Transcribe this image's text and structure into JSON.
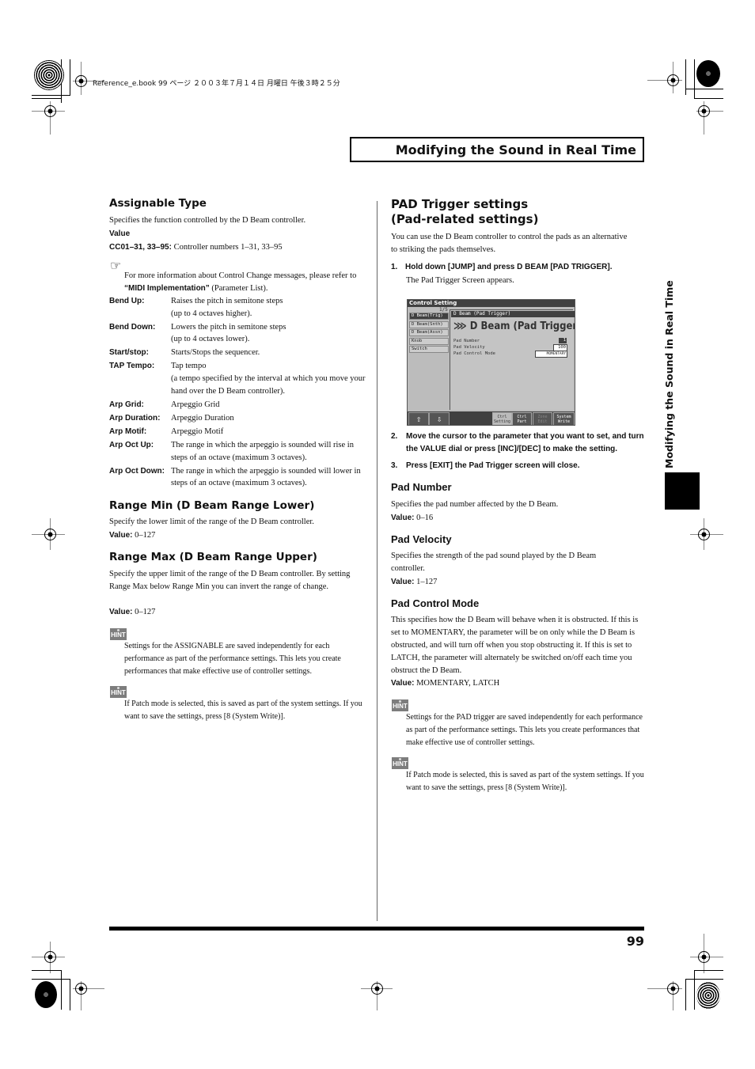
{
  "print_meta": {
    "file_info": "Reference_e.book  99 ページ  ２００３年７月１４日  月曜日  午後３時２５分"
  },
  "header": {
    "section_title": "Modifying the Sound in Real Time"
  },
  "side_tab": {
    "label": "Modifying the Sound in Real Time"
  },
  "left_column": {
    "assignable_type": {
      "heading": "Assignable Type",
      "description": "Specifies the function controlled by the D Beam controller.",
      "value_label": "Value",
      "cc_term": "CC01–31, 33–95:",
      "cc_desc": "Controller numbers 1–31, 33–95",
      "reference_icon": "pointing-hand-icon",
      "reference_text_1": "For more information about Control Change messages, please refer to ",
      "reference_link": "“MIDI Implementation”",
      "reference_text_2": " (Parameter List).",
      "definitions": [
        {
          "term": "Bend Up:",
          "desc": "Raises the pitch in semitone steps",
          "desc2": "(up to 4 octaves higher)."
        },
        {
          "term": "Bend Down:",
          "desc": "Lowers the pitch in semitone steps",
          "desc2": "(up to 4 octaves lower)."
        },
        {
          "term": "Start/stop:",
          "desc": "Starts/Stops the sequencer.",
          "desc2": ""
        },
        {
          "term": "TAP Tempo:",
          "desc": "Tap tempo",
          "desc2": "(a tempo specified by the interval at which you move your hand over the D Beam controller)."
        },
        {
          "term": "Arp Grid:",
          "desc": "Arpeggio Grid",
          "desc2": ""
        },
        {
          "term": "Arp Duration:",
          "desc": "Arpeggio Duration",
          "desc2": ""
        },
        {
          "term": "Arp Motif:",
          "desc": "Arpeggio Motif",
          "desc2": ""
        },
        {
          "term": "Arp Oct Up:",
          "desc": "The range in which the arpeggio is sounded will rise in steps of an octave (maximum 3 octaves).",
          "desc2": ""
        },
        {
          "term": "Arp Oct Down:",
          "desc": "The range in which the arpeggio is sounded will lower in steps of an octave (maximum 3 octaves).",
          "desc2": ""
        }
      ]
    },
    "range_min": {
      "heading": "Range Min (D Beam Range Lower)",
      "description": "Specify the lower limit of the range of the D Beam controller.",
      "value_label": "Value:",
      "value": "0–127"
    },
    "range_max": {
      "heading": "Range Max (D Beam Range Upper)",
      "description": "Specify the upper limit of the range of the D Beam controller. By setting Range Max below Range Min you can invert the range of change.",
      "value_label": "Value:",
      "value": "0–127"
    },
    "hints": [
      {
        "icon_label": "HINT",
        "text": "Settings for the ASSIGNABLE are saved independently for each performance as part of the performance settings. This lets you create performances that make effective use of controller settings."
      },
      {
        "icon_label": "HINT",
        "text": "If Patch mode is selected, this is saved as part of the system settings. If you want to save the settings, press [8 (System Write)]."
      }
    ]
  },
  "right_column": {
    "heading_line1": "PAD Trigger settings",
    "heading_line2": "(Pad-related settings)",
    "intro": "You can use the D Beam controller to control the pads as an alternative to striking the pads themselves.",
    "steps": [
      {
        "num": "1.",
        "text": "Hold down [JUMP] and press D BEAM [PAD TRIGGER].",
        "sub": "The Pad Trigger Screen appears."
      },
      {
        "num": "2.",
        "text": "Move the cursor to the parameter that you want to set, and turn the VALUE dial or press [INC]/[DEC] to make the setting.",
        "sub": ""
      },
      {
        "num": "3.",
        "text": "Press [EXIT] the Pad Trigger screen will close.",
        "sub": ""
      }
    ],
    "screen": {
      "title": "Control Setting",
      "page": "1/5",
      "menu": [
        {
          "label": "D Beam(Trig)",
          "active": true
        },
        {
          "label": "D Beam(Snth)",
          "active": false
        },
        {
          "label": "D Beam(Assn)",
          "active": false
        },
        {
          "label": "Knob",
          "active": false
        },
        {
          "label": "Switch",
          "active": false
        }
      ],
      "panel_title": "D Beam (Pad Trigger)",
      "big_title": "D Beam (Pad Trigger)",
      "params": [
        {
          "label": "Pad Number",
          "value": "1"
        },
        {
          "label": "Pad Velocity",
          "value": "100"
        },
        {
          "label": "Pad Control Mode",
          "value": "MOMENTARY"
        }
      ],
      "buttons": [
        {
          "line1": "Ctrl",
          "line2": "Setting"
        },
        {
          "line1": "Ctrl",
          "line2": "Part"
        },
        {
          "line1": "Zone",
          "line2": "Edit"
        },
        {
          "line1": "System",
          "line2": "Write"
        }
      ],
      "up_arrow": "⇧",
      "down_arrow": "⇩"
    },
    "pad_number": {
      "heading": "Pad Number",
      "description": "Specifies the pad number affected by the D Beam.",
      "value_label": "Value:",
      "value": "0–16"
    },
    "pad_velocity": {
      "heading": "Pad Velocity",
      "description": "Specifies the strength of the pad sound played by the D Beam controller.",
      "value_label": "Value:",
      "value": "1–127"
    },
    "pad_control_mode": {
      "heading": "Pad Control Mode",
      "description": "This specifies how the D Beam will behave when it is obstructed. If this is set to MOMENTARY, the parameter will be on only while the D Beam is obstructed, and will turn off when you stop obstructing it. If this is set to LATCH, the parameter will alternately be switched on/off each time you obstruct the D Beam.",
      "value_label": "Value:",
      "value": "MOMENTARY, LATCH"
    },
    "hints": [
      {
        "icon_label": "HINT",
        "text": "Settings for the PAD trigger are saved independently for each performance as part of the performance settings. This lets you create performances that make effective use of controller settings."
      },
      {
        "icon_label": "HINT",
        "text": "If Patch mode is selected, this is saved as part of the system settings. If you want to save the settings, press [8 (System Write)]."
      }
    ]
  },
  "footer": {
    "page_number": "99"
  }
}
